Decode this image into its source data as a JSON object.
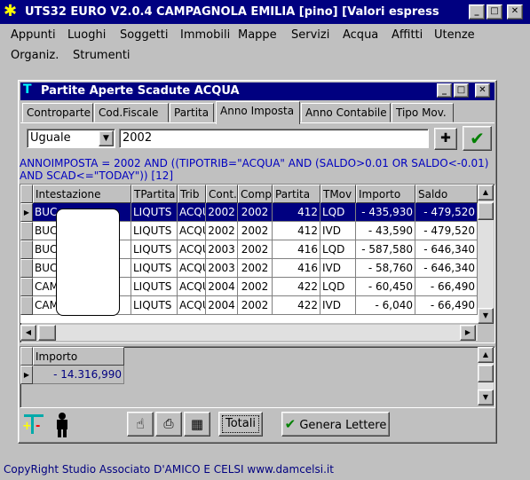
{
  "window": {
    "title": "UTS32 EURO V2.0.4 CAMPAGNOLA EMILIA [pino]  [Valori espress"
  },
  "menu": [
    "Appunti",
    "Luoghi",
    "Soggetti",
    "Immobili",
    "Mappe",
    "Servizi",
    "Acqua",
    "Affitti",
    "Utenze",
    "Organiz.",
    "Strumenti"
  ],
  "child": {
    "title": "Partite Aperte Scadute ACQUA"
  },
  "tabs": [
    "Controparte",
    "Cod.Fiscale",
    "Partita",
    "Anno Imposta",
    "Anno Contabile",
    "Tipo Mov."
  ],
  "filter": {
    "operator": "Uguale",
    "value": "2002"
  },
  "query": {
    "line1": "ANNOIMPOSTA = 2002 AND ((TIPOTRIB=\"ACQUA\" AND (SALDO>0.01 OR SALDO<-0.01)",
    "line2": "AND SCAD<=\"TODAY\")) [12]"
  },
  "grid": {
    "headers": [
      "Intestazione",
      "TPartita",
      "Trib",
      "Cont.",
      "Comp",
      "Partita",
      "TMov",
      "Importo",
      "Saldo"
    ],
    "rows": [
      [
        "BUC",
        "LIQUTS",
        "ACQU",
        "2002",
        "2002",
        "412",
        "LQD",
        "- 435,930",
        "- 479,520"
      ],
      [
        "BUC",
        "LIQUTS",
        "ACQU",
        "2002",
        "2002",
        "412",
        "IVD",
        "- 43,590",
        "- 479,520"
      ],
      [
        "BUC",
        "LIQUTS",
        "ACQU",
        "2003",
        "2002",
        "416",
        "LQD",
        "- 587,580",
        "- 646,340"
      ],
      [
        "BUC",
        "LIQUTS",
        "ACQU",
        "2003",
        "2002",
        "416",
        "IVD",
        "- 58,760",
        "- 646,340"
      ],
      [
        "CAM",
        "LIQUTS",
        "ACQU",
        "2004",
        "2002",
        "422",
        "LQD",
        "- 60,450",
        "- 66,490"
      ],
      [
        "CAM",
        "LIQUTS",
        "ACQU",
        "2004",
        "2002",
        "422",
        "IVD",
        "- 6,040",
        "- 66,490"
      ]
    ]
  },
  "totals": {
    "header": "Importo",
    "value": "- 14.316,990"
  },
  "buttons": {
    "totali": "Totali",
    "genera": "Genera Lettere"
  },
  "status": "CopyRight Studio Associato D'AMICO E CELSI  www.damcelsi.it"
}
